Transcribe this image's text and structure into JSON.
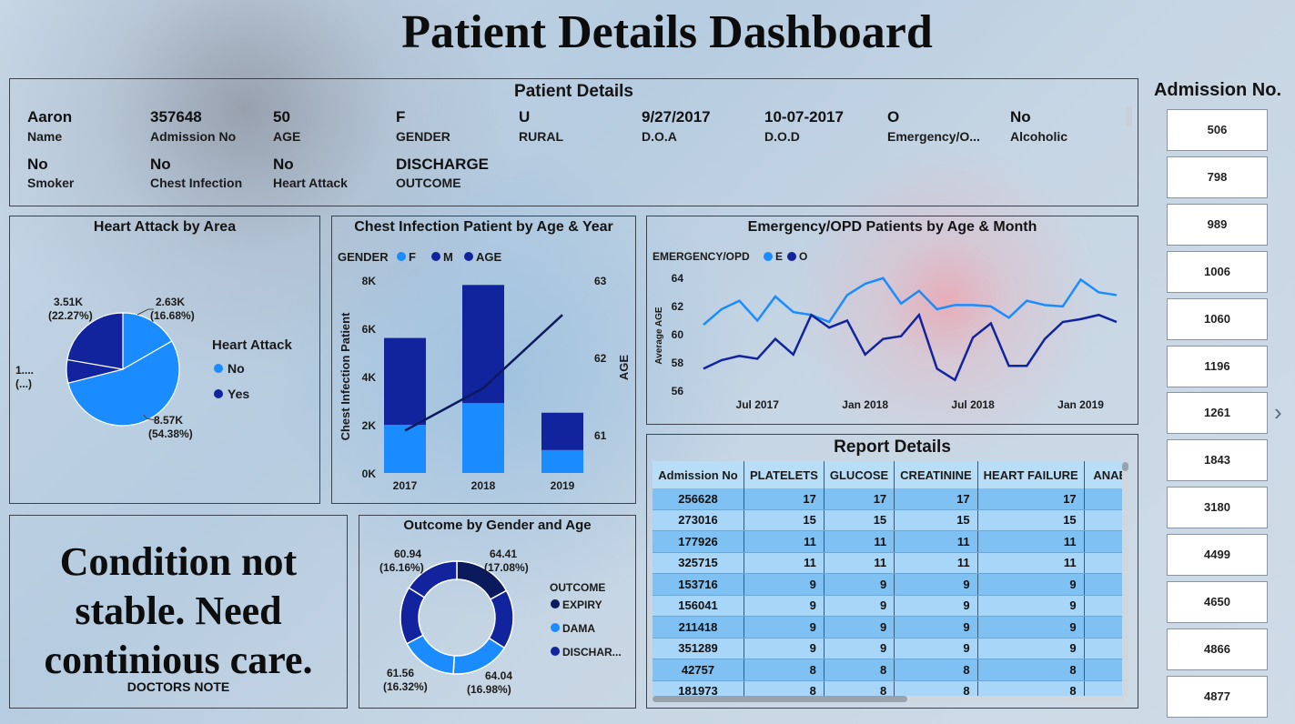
{
  "title": "Patient Details Dashboard",
  "patient_details": {
    "header": "Patient Details",
    "row1": [
      {
        "value": "Aaron",
        "label": "Name"
      },
      {
        "value": "357648",
        "label": "Admission No"
      },
      {
        "value": "50",
        "label": "AGE"
      },
      {
        "value": "F",
        "label": "GENDER"
      },
      {
        "value": "U",
        "label": "RURAL"
      },
      {
        "value": "9/27/2017",
        "label": "D.O.A"
      },
      {
        "value": "10-07-2017",
        "label": "D.O.D"
      },
      {
        "value": "O",
        "label": "Emergency/O..."
      },
      {
        "value": "No",
        "label": "Alcoholic"
      }
    ],
    "row2": [
      {
        "value": "No",
        "label": "Smoker"
      },
      {
        "value": "No",
        "label": "Chest Infection"
      },
      {
        "value": "No",
        "label": "Heart Attack"
      },
      {
        "value": "DISCHARGE",
        "label": "OUTCOME"
      }
    ]
  },
  "heart_attack": {
    "title": "Heart Attack by Area",
    "legend_title": "Heart Attack",
    "legend": [
      {
        "name": "No",
        "color": "#1a8cff"
      },
      {
        "name": "Yes",
        "color": "#12239e"
      }
    ],
    "labels": [
      {
        "v": "3.51K",
        "p": "(22.27%)"
      },
      {
        "v": "2.63K",
        "p": "(16.68%)"
      },
      {
        "v": "1....",
        "p": "(...)"
      },
      {
        "v": "8.57K",
        "p": "(54.38%)"
      }
    ]
  },
  "chest": {
    "title": "Chest Infection Patient by Age & Year",
    "legend_title": "GENDER",
    "legend": [
      {
        "name": "F",
        "color": "#1a8cff"
      },
      {
        "name": "M",
        "color": "#12239e"
      },
      {
        "name": "AGE",
        "color": "#12239e"
      }
    ],
    "ylabel": "Chest Infection Patient",
    "y2label": "AGE",
    "yticks": [
      "8K",
      "6K",
      "4K",
      "2K",
      "0K"
    ],
    "y2ticks": [
      "63",
      "62",
      "61"
    ]
  },
  "emergency": {
    "title": "Emergency/OPD Patients by Age & Month",
    "legend_title": "EMERGENCY/OPD",
    "legend": [
      {
        "name": "E",
        "color": "#1a8cff"
      },
      {
        "name": "O",
        "color": "#12239e"
      }
    ],
    "ylabel": "Average AGE",
    "yticks": [
      "64",
      "62",
      "60",
      "58",
      "56"
    ],
    "xticks": [
      "Jul 2017",
      "Jan 2018",
      "Jul 2018",
      "Jan 2019"
    ]
  },
  "note": {
    "text_lines": [
      "Condition not",
      "stable. Need",
      "continious care."
    ],
    "label": "DOCTORS NOTE"
  },
  "outcome": {
    "title": "Outcome by Gender and Age",
    "legend_title": "OUTCOME",
    "legend": [
      {
        "name": "EXPIRY",
        "color": "#0b1a5c"
      },
      {
        "name": "DAMA",
        "color": "#1a8cff"
      },
      {
        "name": "DISCHAR...",
        "color": "#12239e"
      }
    ],
    "labels": [
      {
        "v": "60.94",
        "p": "(16.16%)"
      },
      {
        "v": "64.41",
        "p": "(17.08%)"
      },
      {
        "v": "61.56",
        "p": "(16.32%)"
      },
      {
        "v": "64.04",
        "p": "(16.98%)"
      }
    ]
  },
  "report": {
    "title": "Report Details",
    "columns": [
      "Admission No",
      "PLATELETS",
      "GLUCOSE",
      "CREATININE",
      "HEART FAILURE",
      "ANAEMIA"
    ],
    "rows": [
      [
        "256628",
        "17",
        "17",
        "17",
        "17"
      ],
      [
        "273016",
        "15",
        "15",
        "15",
        "15"
      ],
      [
        "177926",
        "11",
        "11",
        "11",
        "11"
      ],
      [
        "325715",
        "11",
        "11",
        "11",
        "11"
      ],
      [
        "153716",
        "9",
        "9",
        "9",
        "9"
      ],
      [
        "156041",
        "9",
        "9",
        "9",
        "9"
      ],
      [
        "211418",
        "9",
        "9",
        "9",
        "9"
      ],
      [
        "351289",
        "9",
        "9",
        "9",
        "9"
      ],
      [
        "42757",
        "8",
        "8",
        "8",
        "8"
      ],
      [
        "181973",
        "8",
        "8",
        "8",
        "8"
      ]
    ]
  },
  "admission_slicer": {
    "title": "Admission No.",
    "items": [
      "506",
      "798",
      "989",
      "1006",
      "1060",
      "1196",
      "1261",
      "1843",
      "3180",
      "4499",
      "4650",
      "4866",
      "4877"
    ]
  },
  "chart_data": [
    {
      "type": "pie",
      "title": "Heart Attack by Area",
      "categories": [
        "Yes",
        "No",
        "Yes",
        "No"
      ],
      "values": [
        3510,
        2630,
        1050,
        8570
      ],
      "percent": [
        22.27,
        16.68,
        6.67,
        54.38
      ],
      "legend": "right"
    },
    {
      "type": "bar",
      "stacked": true,
      "title": "Chest Infection Patient by Age & Year",
      "categories": [
        "2017",
        "2018",
        "2019"
      ],
      "series": [
        {
          "name": "F",
          "values": [
            2000,
            2900,
            950
          ]
        },
        {
          "name": "M",
          "values": [
            3600,
            4900,
            1550
          ]
        },
        {
          "name": "AGE",
          "axis": "secondary",
          "type": "line",
          "values": [
            61.05,
            61.6,
            62.55
          ]
        }
      ],
      "ylim": [
        0,
        8000
      ],
      "y2lim": [
        60.5,
        63
      ],
      "ylabel": "Chest Infection Patient",
      "y2label": "AGE"
    },
    {
      "type": "line",
      "title": "Emergency/OPD Patients by Age & Month",
      "x": [
        "2017-04",
        "2017-05",
        "2017-06",
        "2017-07",
        "2017-08",
        "2017-09",
        "2017-10",
        "2017-11",
        "2017-12",
        "2018-01",
        "2018-02",
        "2018-03",
        "2018-04",
        "2018-05",
        "2018-06",
        "2018-07",
        "2018-08",
        "2018-09",
        "2018-10",
        "2018-11",
        "2018-12",
        "2019-01",
        "2019-02",
        "2019-03"
      ],
      "series": [
        {
          "name": "E",
          "values": [
            60.7,
            61.8,
            62.4,
            61.0,
            62.7,
            61.6,
            61.4,
            60.9,
            62.8,
            63.6,
            64.0,
            62.2,
            63.1,
            61.8,
            62.1,
            62.1,
            62.0,
            61.2,
            62.4,
            62.1,
            62.0,
            63.9,
            63.0,
            62.8
          ]
        },
        {
          "name": "O",
          "values": [
            57.6,
            58.2,
            58.5,
            58.3,
            59.7,
            58.6,
            61.4,
            60.5,
            61.0,
            58.6,
            59.7,
            59.9,
            61.4,
            57.6,
            56.8,
            59.8,
            60.8,
            57.8,
            57.8,
            59.7,
            60.9,
            61.1,
            61.4,
            60.9
          ]
        }
      ],
      "ylim": [
        55.5,
        64.5
      ],
      "ylabel": "Average AGE",
      "legend": "top-left"
    },
    {
      "type": "pie",
      "donut": true,
      "title": "Outcome by Gender and Age",
      "values": [
        64.41,
        64.04,
        61.56,
        60.94,
        64.0,
        62.3
      ],
      "percent": [
        17.08,
        16.98,
        16.32,
        16.16
      ],
      "legend": "right"
    }
  ]
}
